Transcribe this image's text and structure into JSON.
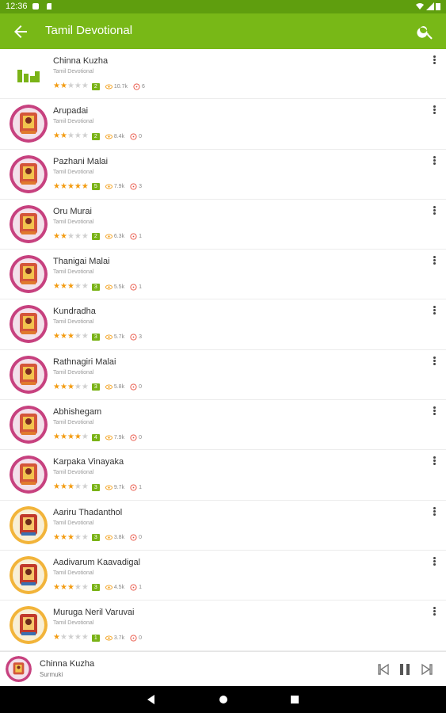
{
  "status": {
    "time": "12:36"
  },
  "appbar": {
    "title": "Tamil Devotional",
    "back_icon": "arrow-left-icon",
    "search_icon": "search-icon"
  },
  "colors": {
    "appbar": "#78b817",
    "statusbar": "#5f9e0e",
    "accent": "#7ab317",
    "star": "#f39c12"
  },
  "items": [
    {
      "title": "Chinna Kuzha",
      "subtitle": "Tamil Devotional",
      "rating": 2,
      "views": "10.7k",
      "comments": "6",
      "thumb": "equalizer"
    },
    {
      "title": "Arupadai",
      "subtitle": "Tamil Devotional",
      "rating": 2,
      "views": "8.4k",
      "comments": "0",
      "thumb": "pink"
    },
    {
      "title": "Pazhani Malai",
      "subtitle": "Tamil Devotional",
      "rating": 5,
      "views": "7.9k",
      "comments": "3",
      "thumb": "pink"
    },
    {
      "title": "Oru Murai",
      "subtitle": "Tamil Devotional",
      "rating": 2,
      "views": "6.3k",
      "comments": "1",
      "thumb": "pink"
    },
    {
      "title": "Thanigai Malai",
      "subtitle": "Tamil Devotional",
      "rating": 3,
      "views": "5.5k",
      "comments": "1",
      "thumb": "pink"
    },
    {
      "title": "Kundradha",
      "subtitle": "Tamil Devotional",
      "rating": 3,
      "views": "5.7k",
      "comments": "3",
      "thumb": "pink"
    },
    {
      "title": "Rathnagiri Malai",
      "subtitle": "Tamil Devotional",
      "rating": 3,
      "views": "5.8k",
      "comments": "0",
      "thumb": "pink"
    },
    {
      "title": "Abhishegam",
      "subtitle": "Tamil Devotional",
      "rating": 4,
      "views": "7.9k",
      "comments": "0",
      "thumb": "pink"
    },
    {
      "title": "Karpaka Vinayaka",
      "subtitle": "Tamil Devotional",
      "rating": 3,
      "views": "9.7k",
      "comments": "1",
      "thumb": "pink"
    },
    {
      "title": "Aariru Thadanthol",
      "subtitle": "Tamil Devotional",
      "rating": 3,
      "views": "3.8k",
      "comments": "0",
      "thumb": "yellow"
    },
    {
      "title": "Aadivarum Kaavadigal",
      "subtitle": "Tamil Devotional",
      "rating": 3,
      "views": "4.5k",
      "comments": "1",
      "thumb": "yellow"
    },
    {
      "title": "Muruga Neril Varuvai",
      "subtitle": "Tamil Devotional",
      "rating": 1,
      "views": "3.7k",
      "comments": "0",
      "thumb": "yellow"
    }
  ],
  "player": {
    "title": "Chinna Kuzha",
    "artist": "Surmuki"
  }
}
